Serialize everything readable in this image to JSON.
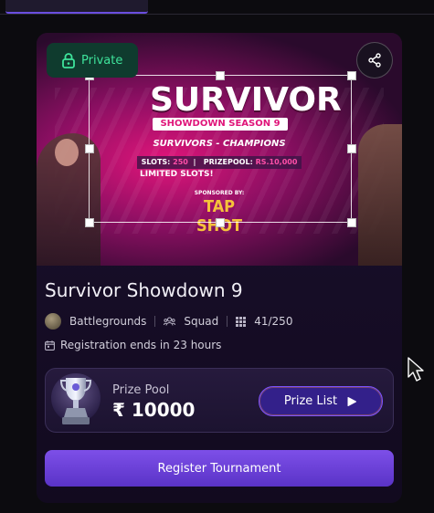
{
  "banner": {
    "headline": "SURVIVOR",
    "subtitle": "SHOWDOWN SEASON 9",
    "tagline": "SURVIVORS - CHAMPIONS",
    "slots_label": "SLOTS:",
    "slots_value": "250",
    "prize_label": "PRIZEPOOL:",
    "prize_value": "RS.10,000",
    "limited": "LIMITED SLOTS!",
    "sponsored": "SPONSORED BY:",
    "sponsor_logo": "TAP SHOT"
  },
  "badge": {
    "label": "Private",
    "icon": "lock-icon"
  },
  "share": {
    "icon": "share-icon"
  },
  "tournament": {
    "title": "Survivor Showdown 9",
    "game": "Battlegrounds",
    "mode": "Squad",
    "slots": "41/250",
    "registration": "Registration ends in 23 hours"
  },
  "prize": {
    "label": "Prize Pool",
    "value": "₹ 10000",
    "list_button": "Prize List"
  },
  "register_button": "Register Tournament",
  "colors": {
    "accent": "#7d4fe8",
    "badge_green": "#3ee39b",
    "banner_pink": "#e0157a"
  }
}
